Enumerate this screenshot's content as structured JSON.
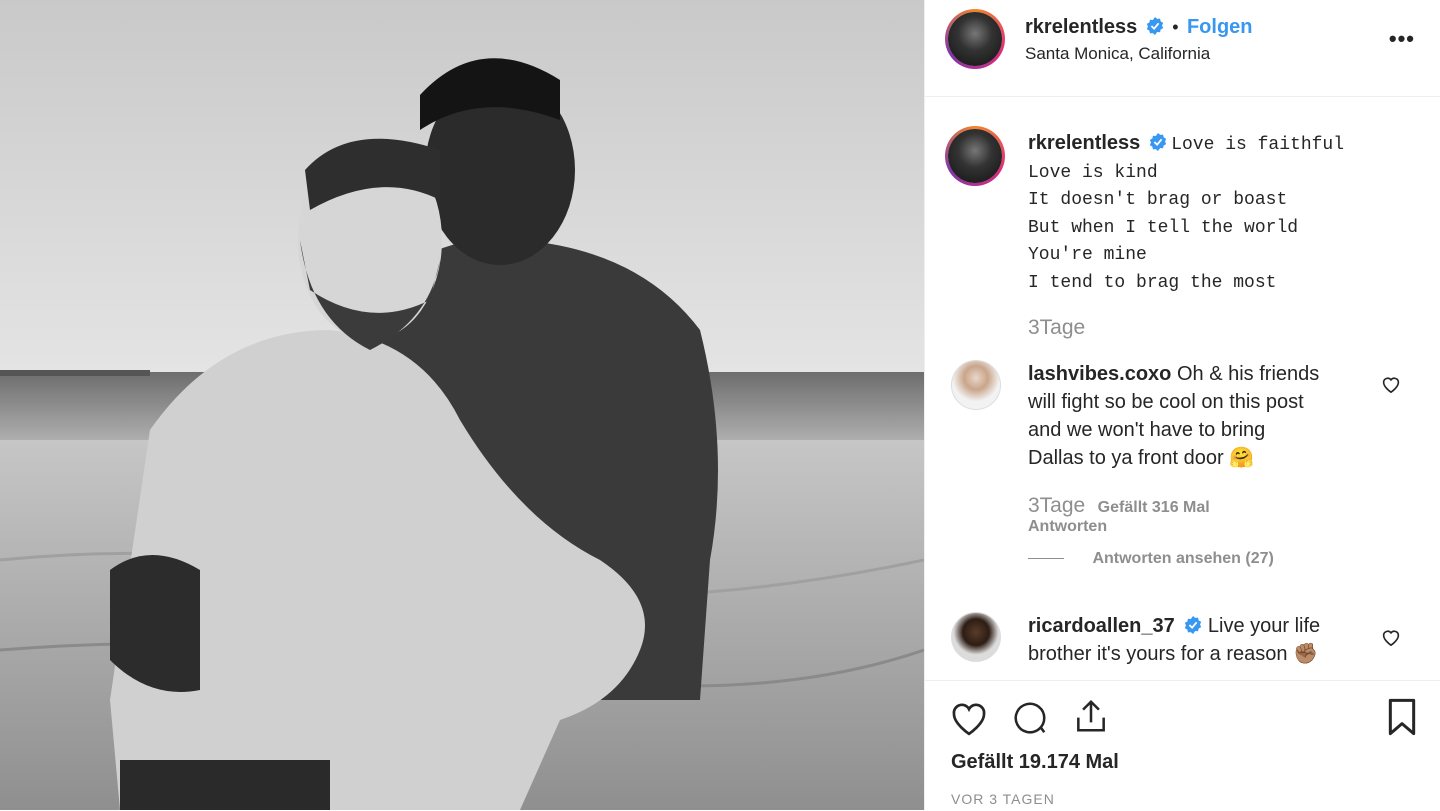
{
  "post": {
    "image_alt": "Black-and-white beach photo of two shirtless men embracing on sand",
    "author": {
      "username": "rkrelentless",
      "verified": true,
      "follow_label": "Folgen",
      "separator": "•",
      "location": "Santa Monica, California"
    },
    "more_icon": "more-options-icon",
    "more_label": "•••",
    "caption": {
      "username": "rkrelentless",
      "lines": [
        "Love is faithful",
        "Love is kind",
        "It doesn't brag or boast",
        "But when I tell the world",
        "You're mine",
        "I tend to brag the most"
      ],
      "age": "3Tage"
    },
    "comments": [
      {
        "username": "lashvibes.coxo",
        "text_lines": [
          "Oh & his friends",
          "will fight so be cool on this post",
          "and we won't have to bring",
          "Dallas to ya front door 🤗"
        ],
        "age": "3Tage",
        "likes": "Gefällt 316 Mal",
        "reply_label": "Antworten",
        "view_replies": "Antworten ansehen (27)"
      },
      {
        "username": "ricardoallen_37",
        "verified": true,
        "text_lines": [
          "Live your life",
          "brother it's yours for a reason ✊🏽"
        ]
      }
    ],
    "likes_count": "Gefällt 19.174 Mal",
    "posted": "VOR 3 TAGEN",
    "colors": {
      "accent": "#3897f0",
      "text": "#262626",
      "muted": "#8e8e8e"
    }
  }
}
